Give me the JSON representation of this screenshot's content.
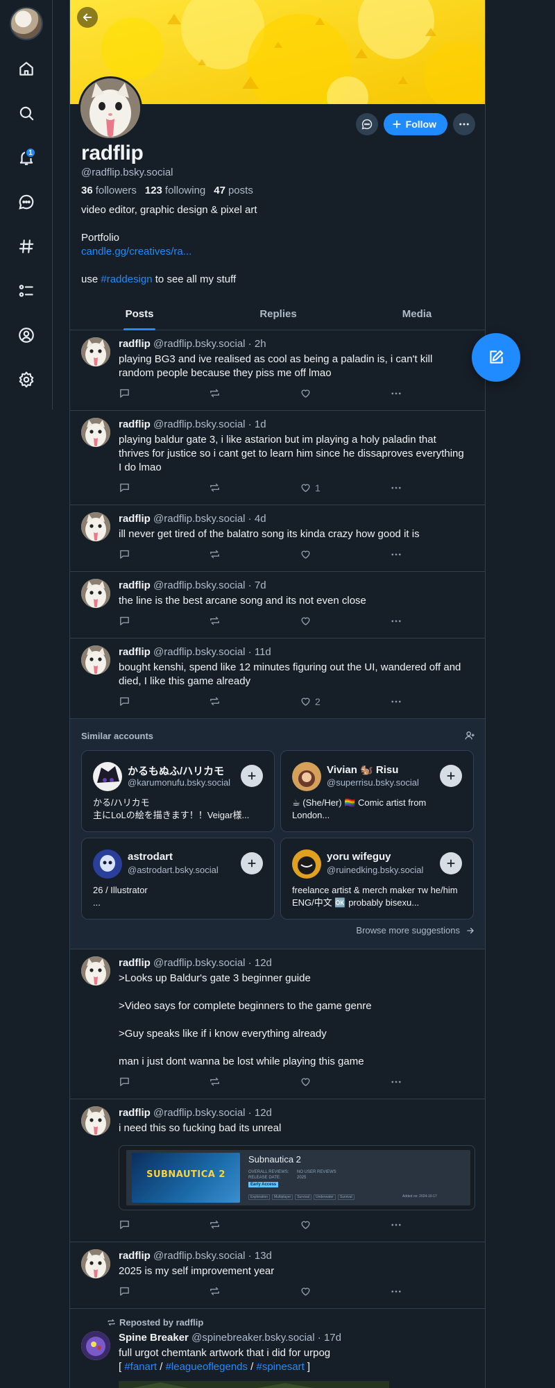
{
  "rail": {
    "items": [
      {
        "icon": "home-icon"
      },
      {
        "icon": "search-icon"
      },
      {
        "icon": "bell-icon",
        "badge": "1"
      },
      {
        "icon": "chat-icon"
      },
      {
        "icon": "hashtag-icon"
      },
      {
        "icon": "list-icon"
      },
      {
        "icon": "profile-icon"
      },
      {
        "icon": "gear-icon"
      }
    ]
  },
  "profile": {
    "name": "radflip",
    "handle": "@radflip.bsky.social",
    "followers_count": "36",
    "followers_label": "followers",
    "following_count": "123",
    "following_label": "following",
    "posts_count": "47",
    "posts_label": "posts",
    "bio_line1": "video editor, graphic design & pixel art",
    "bio_portfolio": "Portfolio",
    "bio_link": "candle.gg/creatives/ra...",
    "bio_use_prefix": "use ",
    "bio_use_tag": "#raddesign",
    "bio_use_suffix": " to see all my stuff",
    "follow_label": "Follow",
    "colors": {
      "accent": "#208bfe",
      "banner": "#fbd90b",
      "bg": "#161e27"
    }
  },
  "tabs": [
    {
      "label": "Posts",
      "active": true
    },
    {
      "label": "Replies",
      "active": false
    },
    {
      "label": "Media",
      "active": false
    }
  ],
  "posts": [
    {
      "author": "radflip",
      "handle": "@radflip.bsky.social",
      "time": " · 2h",
      "text": "playing BG3 and ive realised as cool as being a paladin is, i can't kill random people because they piss me off lmao",
      "likes": ""
    },
    {
      "author": "radflip",
      "handle": "@radflip.bsky.social",
      "time": " · 1d",
      "text": "playing baldur gate 3, i like astarion but im playing a holy paladin that thrives for justice so i cant get to learn him since he dissaproves everything I do lmao",
      "likes": "1"
    },
    {
      "author": "radflip",
      "handle": "@radflip.bsky.social",
      "time": " · 4d",
      "text": "ill never get tired of the balatro song its kinda crazy how good it is",
      "likes": ""
    },
    {
      "author": "radflip",
      "handle": "@radflip.bsky.social",
      "time": " · 7d",
      "text": "the line is the best arcane song and its not even close",
      "likes": ""
    },
    {
      "author": "radflip",
      "handle": "@radflip.bsky.social",
      "time": " · 11d",
      "text": "bought kenshi, spend like 12 minutes figuring out the UI, wandered off and died, I like this game already",
      "likes": "2"
    },
    {
      "author": "radflip",
      "handle": "@radflip.bsky.social",
      "time": " · 12d",
      "text": ">Looks up Baldur's gate 3 beginner guide\n\n>Video says for complete beginners to the game genre\n\n>Guy speaks like if i know everything already\n\nman i just dont wanna be lost while playing this game",
      "likes": ""
    },
    {
      "author": "radflip",
      "handle": "@radflip.bsky.social",
      "time": " · 12d",
      "text": "i need this so fucking bad its unreal",
      "likes": ""
    },
    {
      "author": "radflip",
      "handle": "@radflip.bsky.social",
      "time": " · 13d",
      "text": "2025 is my self improvement year",
      "likes": ""
    }
  ],
  "similar": {
    "title": "Similar accounts",
    "browse": "Browse more suggestions",
    "cards": [
      {
        "name": "かるもぬふ/ハリカモ",
        "handle": "@karumonufu.bsky.social",
        "desc": "かる/ハリカモ\n主にLoLの絵を描きます！！Veigar様..."
      },
      {
        "name": "Vivian 🐿️ Risu",
        "handle": "@superrisu.bsky.social",
        "desc": "☕ (She/Her) 🏳️‍🌈 Comic artist from London..."
      },
      {
        "name": "astrodart",
        "handle": "@astrodart.bsky.social",
        "desc": "26 / Illustrator\n..."
      },
      {
        "name": "yoru wifeguy",
        "handle": "@ruinedking.bsky.social",
        "desc": "freelance artist & merch maker ᴛᴡ he/him ENG/中文 🆗 probably bisexu..."
      }
    ]
  },
  "embed": {
    "title": "Subnautica 2",
    "logo": "SUBNAUTICA 2",
    "reviews_label": "OVERALL REVIEWS:",
    "reviews_value": "NO USER REVIEWS",
    "release_label": "RELEASE DATE:",
    "release_value": "2025",
    "early_access": "Early Access",
    "tags": [
      "Exploration",
      "Multiplayer",
      "Survival",
      "Underwater",
      "Survival"
    ],
    "added": "Added on: 2024-10-17"
  },
  "repost": {
    "label": "Reposted by radflip",
    "author": "Spine Breaker",
    "handle": "@spinebreaker.bsky.social",
    "time": " · 17d",
    "text": "full urgot chemtank artwork that i did for urpog",
    "tag_open": "[ ",
    "tag1": "#fanart",
    "sep1": " / ",
    "tag2": "#leagueoflegends",
    "sep2": " / ",
    "tag3": "#spinesart",
    "tag_close": " ]"
  }
}
